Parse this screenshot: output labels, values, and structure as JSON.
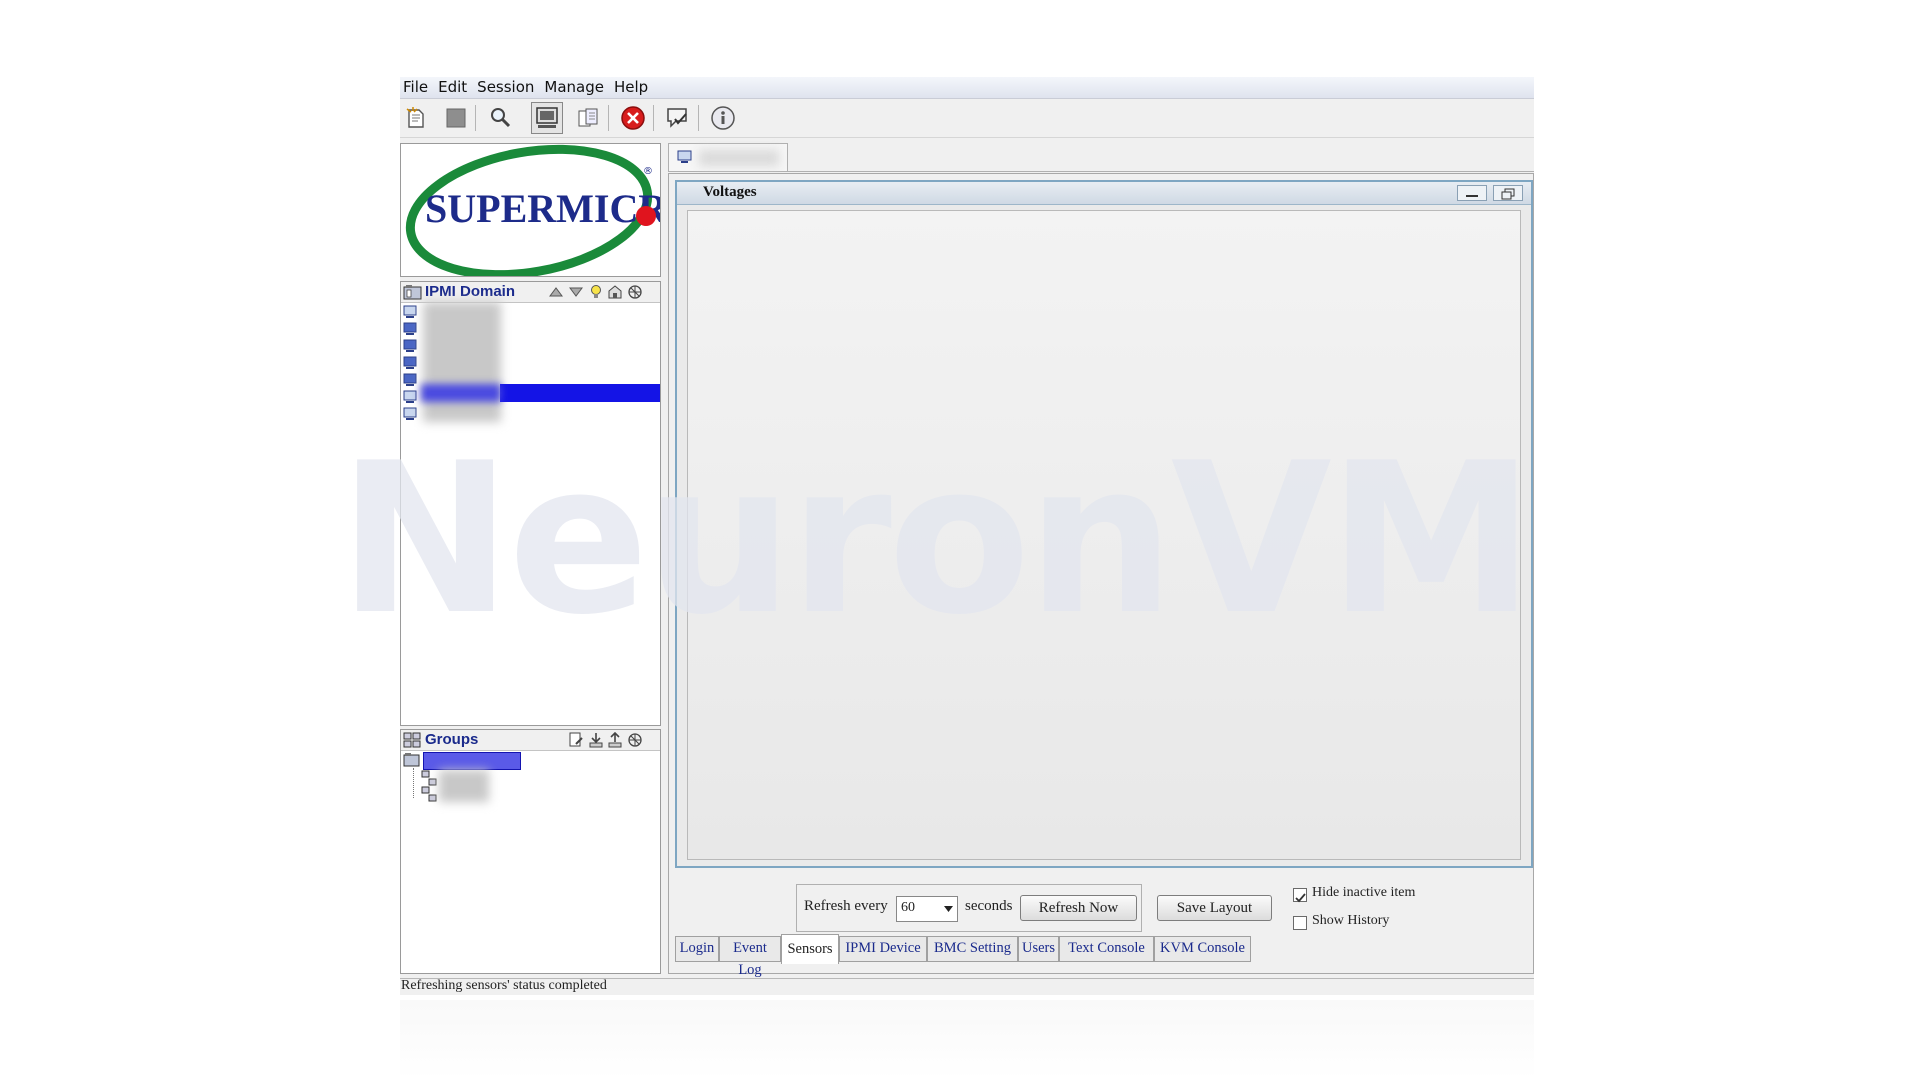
{
  "menu": [
    "File",
    "Edit",
    "Session",
    "Manage",
    "Help"
  ],
  "toolbar": {
    "icons": [
      "new-icon",
      "stop-icon",
      "search-icon",
      "monitor-icon",
      "copy-icon",
      "close-icon",
      "chat-icon",
      "info-icon"
    ]
  },
  "logo": {
    "text": "SUPERMICR",
    "registered": "®"
  },
  "domain": {
    "title": "IPMI Domain"
  },
  "groups": {
    "title": "Groups"
  },
  "sensors": {
    "frame_title": "Voltages",
    "refresh_label": "Refresh every",
    "refresh_value": "60",
    "seconds_label": "seconds",
    "refresh_now": "Refresh Now",
    "save_layout": "Save Layout",
    "hide_inactive": {
      "label": "Hide inactive item",
      "checked": true
    },
    "show_history": {
      "label": "Show History",
      "checked": false
    }
  },
  "tabs": [
    "Login",
    "Event Log",
    "Sensors",
    "IPMI Device",
    "BMC Setting",
    "Users",
    "Text Console",
    "KVM Console"
  ],
  "active_tab": "Sensors",
  "status": "Refreshing sensors' status completed",
  "watermark": "NeuronVM",
  "colors": {
    "selection": "#1414e6",
    "tab_text": "#1a2a8c",
    "frame_border": "#7ea6c2",
    "logo_green": "#1a8a3a",
    "logo_blue": "#1d2b8a",
    "logo_red": "#e0141e"
  }
}
